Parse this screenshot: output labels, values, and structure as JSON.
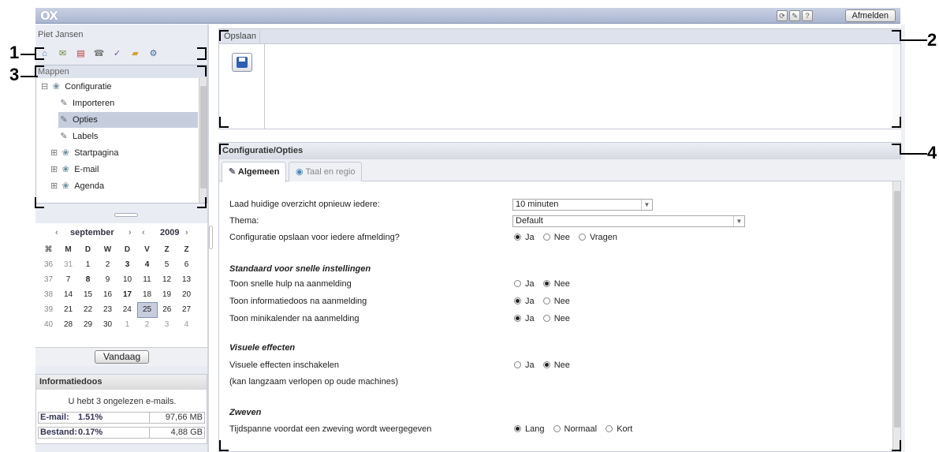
{
  "topbar": {
    "logo": "OX",
    "refresh_icon": "⟳",
    "settings_icon": "✎",
    "help_icon": "?",
    "logout_label": "Afmelden"
  },
  "user": {
    "name": "Piet Jansen"
  },
  "app_icons": [
    {
      "name": "home-icon",
      "glyph": "⌂",
      "color": "#5a7bb5"
    },
    {
      "name": "mail-icon",
      "glyph": "✉",
      "color": "#6a8a3a"
    },
    {
      "name": "calendar-icon",
      "glyph": "▤",
      "color": "#c03030"
    },
    {
      "name": "contacts-icon",
      "glyph": "☎",
      "color": "#7a7a7a"
    },
    {
      "name": "tasks-icon",
      "glyph": "✓",
      "color": "#7a4ab0"
    },
    {
      "name": "infostore-icon",
      "glyph": "▰",
      "color": "#d6a020"
    },
    {
      "name": "configuration-icon",
      "glyph": "⚙",
      "color": "#3a6aa0"
    }
  ],
  "folders": {
    "header": "Mappen",
    "items": [
      {
        "label": "Configuratie",
        "expander": "⊟",
        "icon": "❀"
      },
      {
        "label": "Importeren",
        "expander": "",
        "icon": "✎"
      },
      {
        "label": "Opties",
        "expander": "",
        "icon": "✎"
      },
      {
        "label": "Labels",
        "expander": "",
        "icon": "✎"
      },
      {
        "label": "Startpagina",
        "expander": "⊞",
        "icon": "❀"
      },
      {
        "label": "E-mail",
        "expander": "⊞",
        "icon": "❀"
      },
      {
        "label": "Agenda",
        "expander": "⊞",
        "icon": "❀"
      }
    ]
  },
  "calendar": {
    "prev_month": "‹",
    "month": "september",
    "next_month": "›",
    "prev_year": "‹",
    "year": "2009",
    "next_year": "›",
    "week_icon": "⌘",
    "weekdays": [
      "M",
      "D",
      "W",
      "D",
      "V",
      "Z",
      "Z"
    ],
    "weeks": [
      {
        "wk": "36",
        "days": [
          "31",
          "1",
          "2",
          "3",
          "4",
          "5",
          "6"
        ]
      },
      {
        "wk": "37",
        "days": [
          "7",
          "8",
          "9",
          "10",
          "11",
          "12",
          "13"
        ]
      },
      {
        "wk": "38",
        "days": [
          "14",
          "15",
          "16",
          "17",
          "18",
          "19",
          "20"
        ]
      },
      {
        "wk": "39",
        "days": [
          "21",
          "22",
          "23",
          "24",
          "25",
          "26",
          "27"
        ]
      },
      {
        "wk": "40",
        "days": [
          "28",
          "29",
          "30",
          "1",
          "2",
          "3",
          "4"
        ]
      }
    ],
    "today_label": "Vandaag"
  },
  "infobox": {
    "title": "Informatiedoos",
    "message": "U hebt 3 ongelezen e-mails.",
    "email_label": "E-mail:",
    "email_percent": "1.51%",
    "email_size": "97,66 MB",
    "file_label": "Bestand:",
    "file_percent": "0.17%",
    "file_size": "4,88 GB"
  },
  "savepane": {
    "tab_label": "Opslaan"
  },
  "panel": {
    "title": "Configuratie/Opties",
    "tab_general": "Algemeen",
    "tab_region": "Taal en regio",
    "rows": {
      "reload_label": "Laad huidige overzicht opnieuw iedere:",
      "reload_value": "10 minuten",
      "theme_label": "Thema:",
      "theme_value": "Default",
      "save_config_label": "Configuratie opslaan voor iedere afmelding?",
      "opt_yes": "Ja",
      "opt_no": "Nee",
      "opt_ask": "Vragen",
      "section_quick": "Standaard voor snelle instellingen",
      "quickhelp_label": "Toon snelle hulp na aanmelding",
      "infobox_label": "Toon informatiedoos na aanmelding",
      "minical_label": "Toon minikalender na aanmelding",
      "section_visual": "Visuele effecten",
      "effects_label": "Visuele effecten inschakelen",
      "effects_note": "(kan langzaam verlopen op oude machines)",
      "section_hover": "Zweven",
      "hover_label": "Tijdspanne voordat een zweving wordt weergegeven",
      "opt_long": "Lang",
      "opt_normal": "Normaal",
      "opt_short": "Kort"
    }
  },
  "callouts": {
    "c1": "1",
    "c2": "2",
    "c3": "3",
    "c4": "4"
  }
}
